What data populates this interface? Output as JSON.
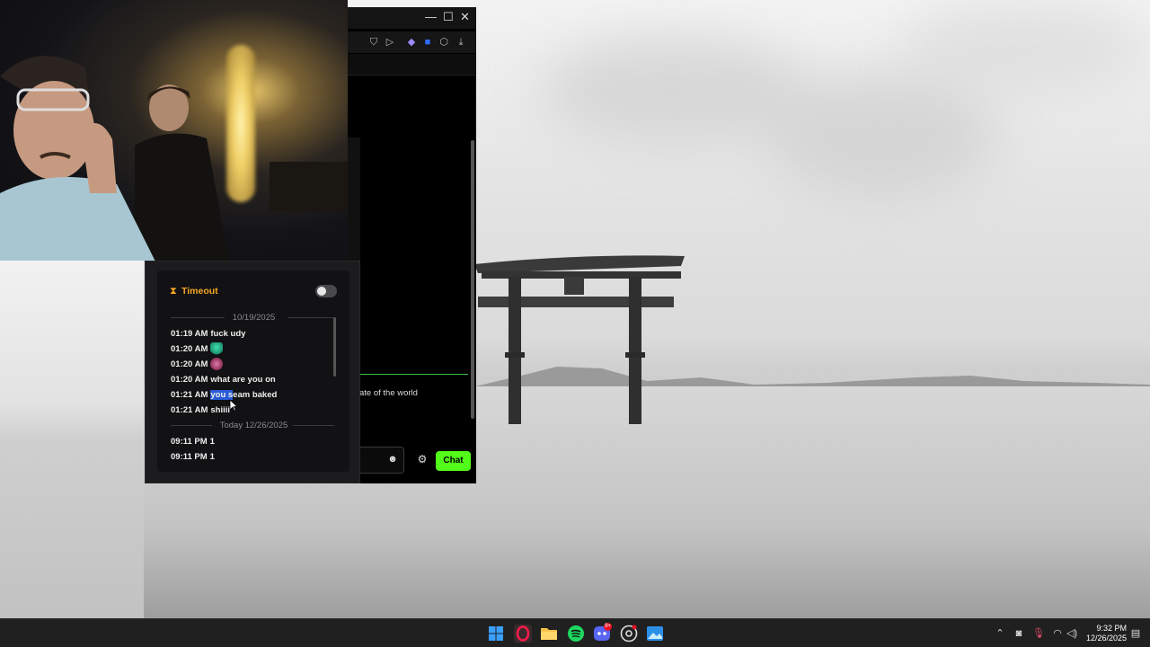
{
  "window": {
    "minimize_glyph": "—",
    "maximize_glyph": "☐",
    "close_glyph": "✕"
  },
  "chat_app": {
    "visible_message_fragment": "ate of the world",
    "chat_button_label": "Chat",
    "accent_color": "#53fc18"
  },
  "timeout_popup": {
    "title": "Timeout",
    "title_color": "#f5a623",
    "toggle_on": false,
    "log": [
      {
        "type": "date",
        "label": "10/19/2025"
      },
      {
        "type": "msg",
        "time": "01:19 AM",
        "text": "fuck udy"
      },
      {
        "type": "msg",
        "time": "01:20 AM",
        "text": "",
        "emote": "green-emote"
      },
      {
        "type": "msg",
        "time": "01:20 AM",
        "text": "",
        "emote": "pink-emote"
      },
      {
        "type": "msg",
        "time": "01:20 AM",
        "text": "what are you on"
      },
      {
        "type": "msg",
        "time": "01:21 AM",
        "text_highlight": "you s",
        "text_rest": "eam baked"
      },
      {
        "type": "msg",
        "time": "01:21 AM",
        "text": "shiiii"
      },
      {
        "type": "date",
        "label": "Today 12/26/2025"
      },
      {
        "type": "msg",
        "time": "09:11 PM",
        "text": "1"
      },
      {
        "type": "msg",
        "time": "09:11 PM",
        "text": "1"
      }
    ]
  },
  "taskbar": {
    "apps": [
      "windows-start-icon",
      "opera-gx-icon",
      "file-explorer-icon",
      "spotify-icon",
      "discord-icon",
      "chrome-icon",
      "photos-icon"
    ],
    "discord_badge": "9+",
    "clock_time": "9:32 PM",
    "clock_date": "12/26/2025"
  }
}
